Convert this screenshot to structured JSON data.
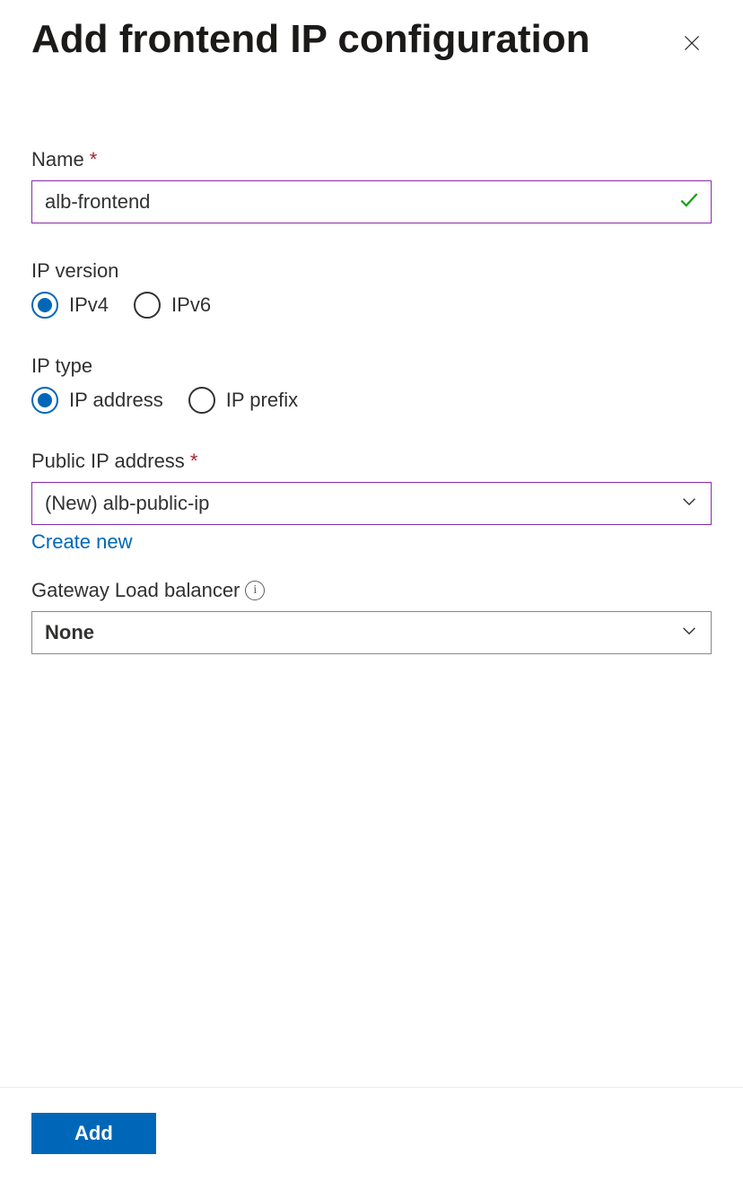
{
  "header": {
    "title": "Add frontend IP configuration"
  },
  "fields": {
    "name": {
      "label": "Name",
      "value": "alb-frontend"
    },
    "ip_version": {
      "label": "IP version",
      "options": [
        "IPv4",
        "IPv6"
      ],
      "selected": "IPv4"
    },
    "ip_type": {
      "label": "IP type",
      "options": [
        "IP address",
        "IP prefix"
      ],
      "selected": "IP address"
    },
    "public_ip": {
      "label": "Public IP address",
      "value": "(New) alb-public-ip",
      "create_link": "Create new"
    },
    "gateway_lb": {
      "label": "Gateway Load balancer",
      "value": "None"
    }
  },
  "footer": {
    "add_label": "Add"
  }
}
